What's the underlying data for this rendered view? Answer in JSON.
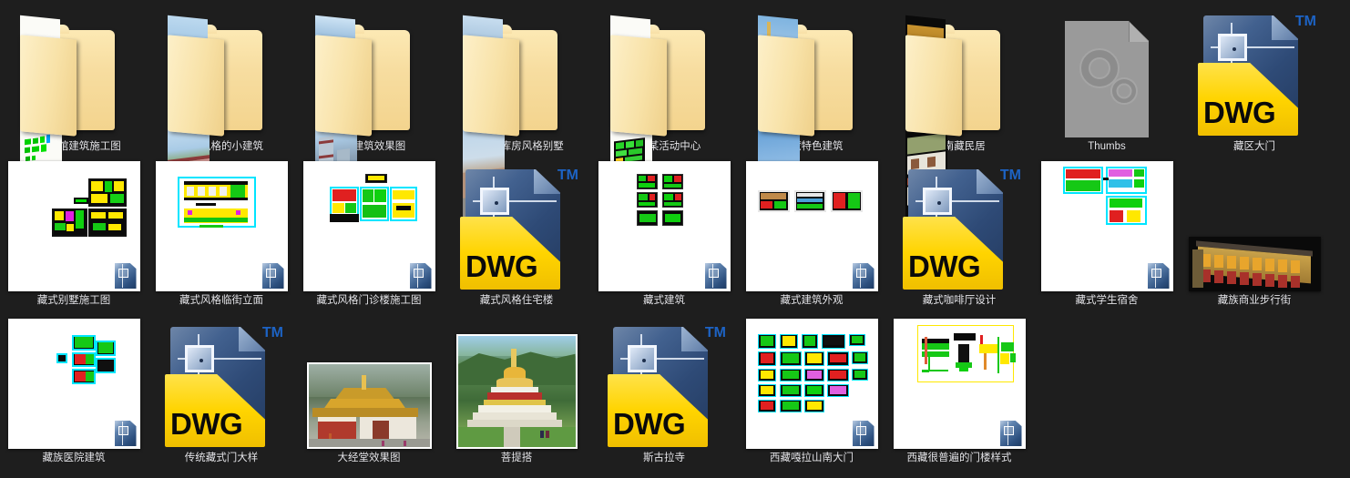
{
  "window": {
    "background_color": "#1e1e1e",
    "label_color": "#e8e8ec",
    "accent_dwg_yellow": "#ffd400",
    "accent_dwg_blue": "#2e4a76",
    "tm_color": "#1d63c4"
  },
  "items": [
    {
      "name": "藏式宾馆建筑施工图",
      "type": "folder",
      "variant": "cad-pages",
      "row": 1,
      "col": 1
    },
    {
      "name": "藏式风格的小建筑",
      "type": "folder",
      "variant": "photo-pages",
      "row": 1,
      "col": 2
    },
    {
      "name": "藏式建筑效果图",
      "type": "folder",
      "variant": "photo-pages",
      "row": 1,
      "col": 3
    },
    {
      "name": "藏族土库房风格别墅",
      "type": "folder",
      "variant": "photo-pages",
      "row": 1,
      "col": 4
    },
    {
      "name": "拉萨某活动中心",
      "type": "folder",
      "variant": "cad-pages",
      "row": 1,
      "col": 5
    },
    {
      "name": "西藏特色建筑",
      "type": "folder",
      "variant": "photo-pages",
      "row": 1,
      "col": 6
    },
    {
      "name": "云南藏民居",
      "type": "folder",
      "variant": "photo-pages",
      "row": 1,
      "col": 7
    },
    {
      "name": "Thumbs",
      "type": "system-file",
      "variant": "gears",
      "row": 1,
      "col": 8
    },
    {
      "name": "藏区大门",
      "type": "dwg",
      "badge": "DWG",
      "tm": "TM",
      "row": 1,
      "col": 9
    },
    {
      "name": "藏式别墅施工图",
      "type": "cad-thumb",
      "row": 2,
      "col": 1
    },
    {
      "name": "藏式风格临街立面",
      "type": "cad-thumb",
      "row": 2,
      "col": 2
    },
    {
      "name": "藏式风格门诊楼施工图",
      "type": "cad-thumb",
      "row": 2,
      "col": 3
    },
    {
      "name": "藏式风格住宅楼",
      "type": "dwg",
      "badge": "DWG",
      "tm": "TM",
      "row": 2,
      "col": 4
    },
    {
      "name": "藏式建筑",
      "type": "cad-thumb",
      "row": 2,
      "col": 5
    },
    {
      "name": "藏式建筑外观",
      "type": "cad-thumb",
      "row": 2,
      "col": 6
    },
    {
      "name": "藏式咖啡厅设计",
      "type": "dwg",
      "badge": "DWG",
      "tm": "TM",
      "row": 2,
      "col": 7
    },
    {
      "name": "藏式学生宿舍",
      "type": "cad-thumb",
      "row": 2,
      "col": 8
    },
    {
      "name": "藏族商业步行街",
      "type": "photo-thumb",
      "row": 2,
      "col": 9
    },
    {
      "name": "藏族医院建筑",
      "type": "cad-thumb",
      "row": 3,
      "col": 1
    },
    {
      "name": "传统藏式门大样",
      "type": "dwg",
      "badge": "DWG",
      "tm": "TM",
      "row": 3,
      "col": 2
    },
    {
      "name": "大经堂效果图",
      "type": "photo-thumb",
      "row": 3,
      "col": 3
    },
    {
      "name": "菩提搭",
      "type": "photo-thumb",
      "row": 3,
      "col": 4
    },
    {
      "name": "斯古拉寺",
      "type": "dwg",
      "badge": "DWG",
      "tm": "TM",
      "row": 3,
      "col": 5
    },
    {
      "name": "西藏嘎拉山南大门",
      "type": "cad-thumb",
      "row": 3,
      "col": 6
    },
    {
      "name": "西藏很普遍的门楼样式",
      "type": "cad-thumb",
      "row": 3,
      "col": 7
    }
  ]
}
